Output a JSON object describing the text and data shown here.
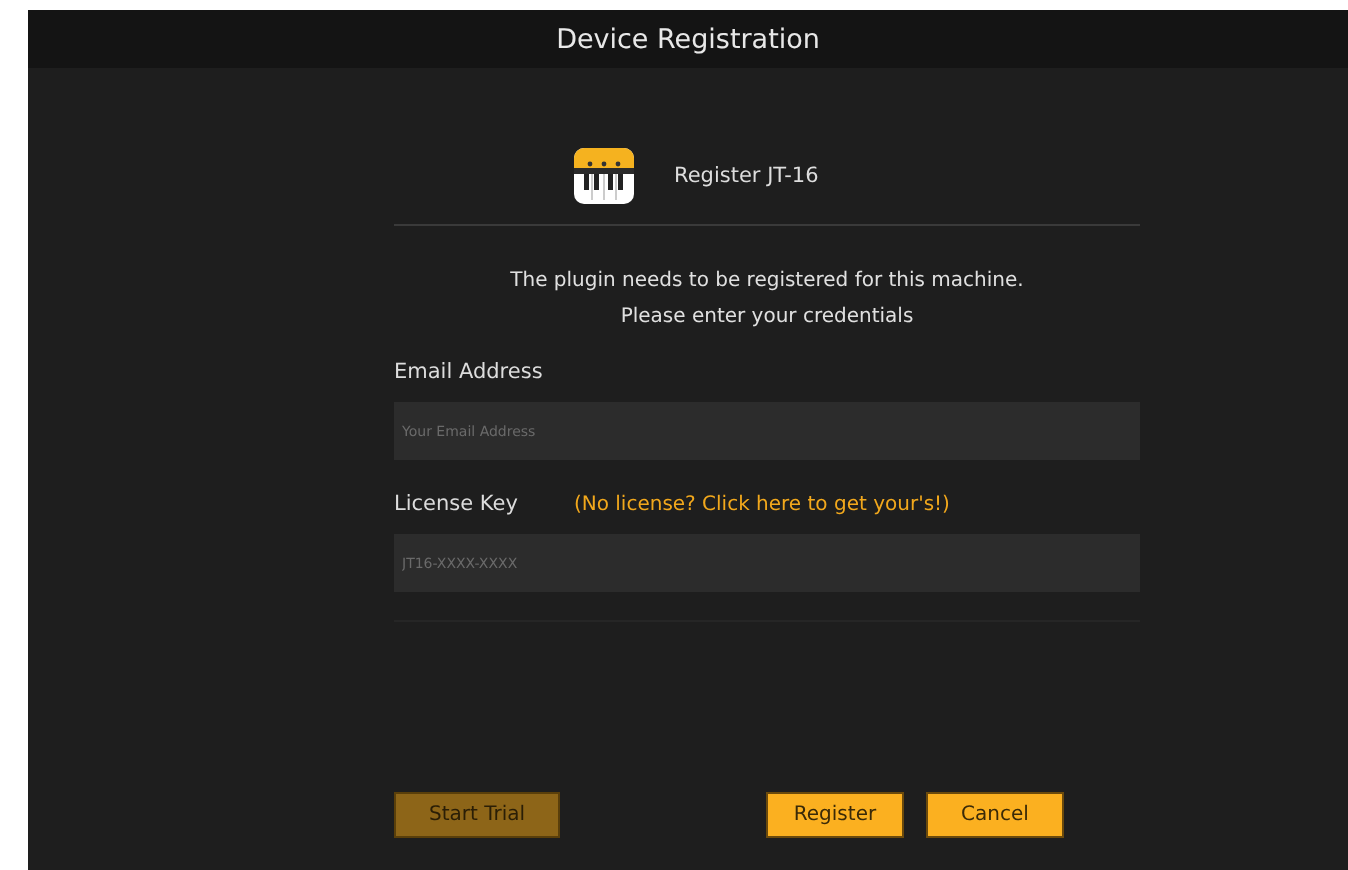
{
  "window": {
    "title": "Device Registration"
  },
  "header": {
    "title": "Register JT-16"
  },
  "message": [
    "The plugin needs to be registered for this machine.",
    "Please enter your credentials"
  ],
  "fields": [
    {
      "label": "Email Address",
      "placeholder": "Your Email Address"
    },
    {
      "label": "License Key",
      "link": "(No license? Click here to get your's!)",
      "placeholder": "JT16-XXXX-XXXX"
    }
  ],
  "buttons": [
    {
      "label": "Start Trial",
      "disabled": true
    },
    {
      "label": "Register",
      "disabled": false
    },
    {
      "label": "Cancel",
      "disabled": false
    }
  ]
}
